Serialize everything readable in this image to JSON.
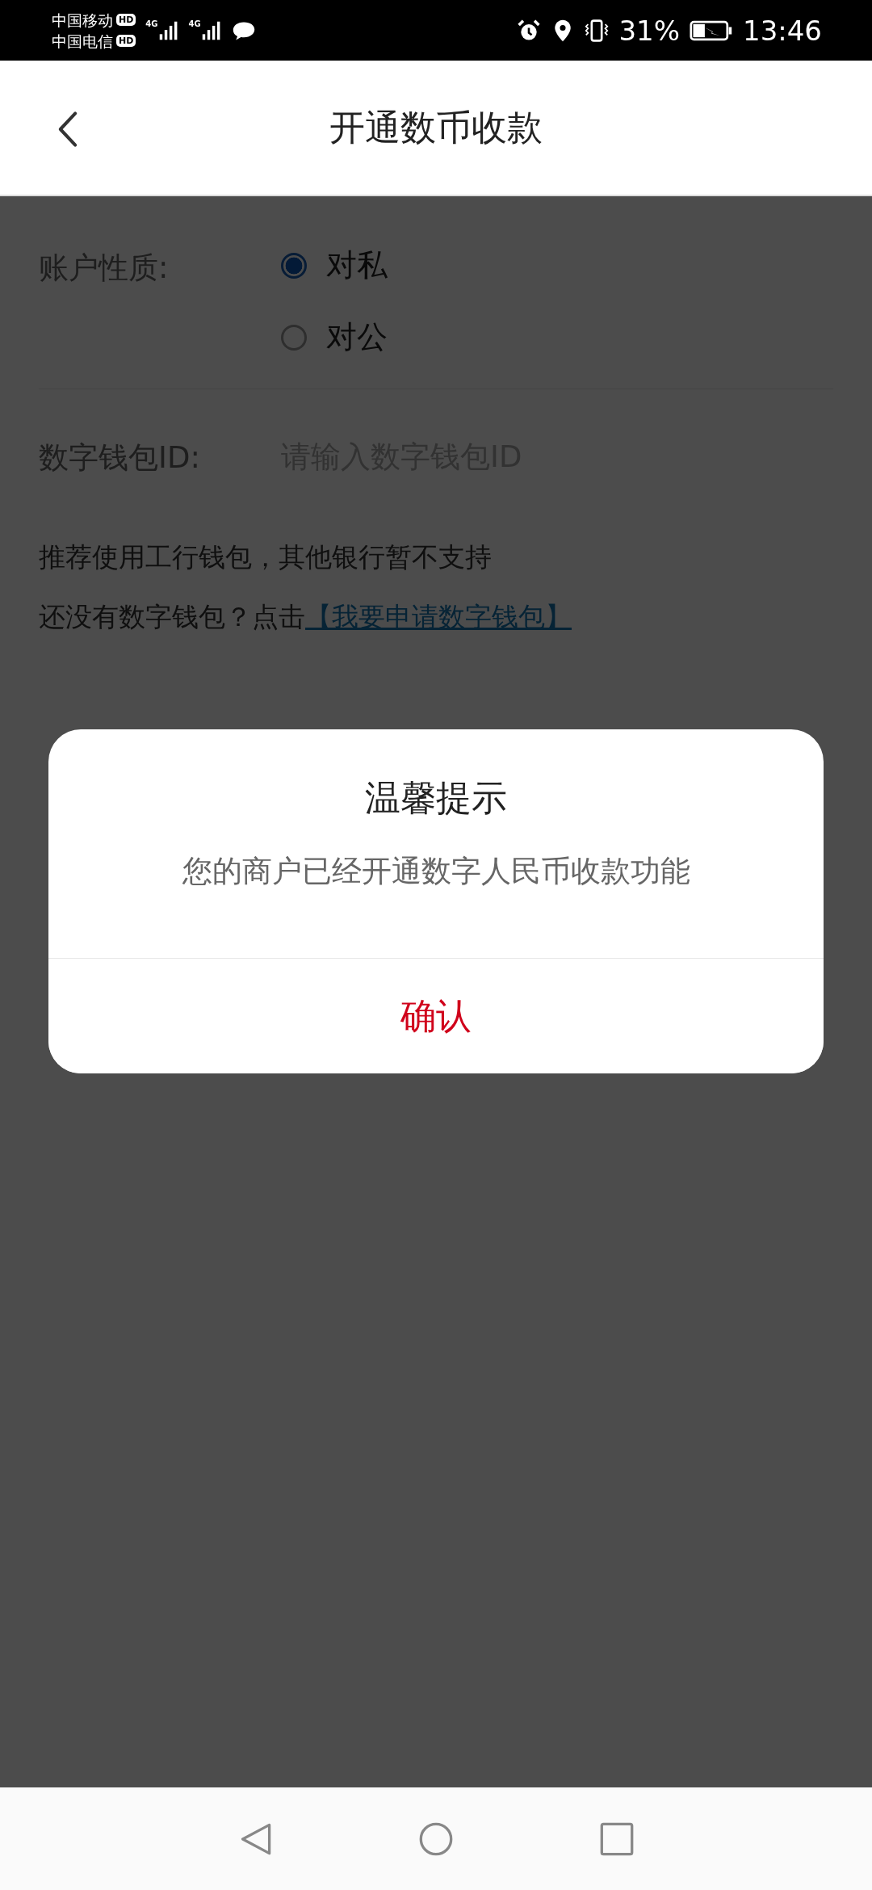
{
  "status_bar": {
    "carriers": [
      {
        "name": "中国移动",
        "badge": "HD"
      },
      {
        "name": "中国电信",
        "badge": "HD"
      }
    ],
    "network": [
      "4G",
      "4G"
    ],
    "battery": "31%",
    "time": "13:46"
  },
  "header": {
    "title": "开通数币收款"
  },
  "form": {
    "account_type": {
      "label": "账户性质:",
      "options": [
        {
          "label": "对私",
          "selected": true
        },
        {
          "label": "对公",
          "selected": false
        }
      ]
    },
    "wallet_id": {
      "label": "数字钱包ID:",
      "placeholder": "请输入数字钱包ID"
    },
    "note": "推荐使用工行钱包，其他银行暂不支持",
    "apply": {
      "text": "还没有数字钱包？点击",
      "link": "【我要申请数字钱包】"
    }
  },
  "dialog": {
    "title": "温馨提示",
    "message": "您的商户已经开通数字人民币收款功能",
    "button": "确认"
  }
}
